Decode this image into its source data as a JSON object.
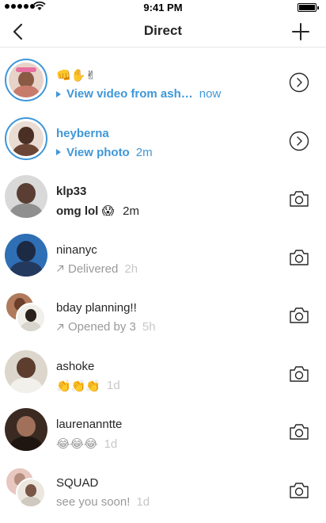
{
  "status_bar": {
    "time": "9:41 PM"
  },
  "header": {
    "title": "Direct"
  },
  "threads": [
    {
      "name": "👊✋✌",
      "subtitle": "View video from ash…",
      "time": "now",
      "action": "chevron-right-icon"
    },
    {
      "name": "heyberna",
      "subtitle": "View photo",
      "time": "2m",
      "action": "chevron-right-icon"
    },
    {
      "name": "klp33",
      "subtitle": "omg lol 😱",
      "time": "2m",
      "action": "camera-icon"
    },
    {
      "name": "ninanyc",
      "subtitle": "Delivered",
      "time": "2h",
      "action": "camera-icon"
    },
    {
      "name": "bday planning!!",
      "subtitle": "Opened by 3",
      "time": "5h",
      "action": "camera-icon"
    },
    {
      "name": "ashoke",
      "subtitle": "👏👏👏",
      "time": "1d",
      "action": "camera-icon"
    },
    {
      "name": "laurenanntte",
      "subtitle": "😂😂😂",
      "time": "1d",
      "action": "camera-icon"
    },
    {
      "name": "SQUAD",
      "subtitle": "see you soon!",
      "time": "1d",
      "action": "camera-icon"
    }
  ],
  "colors": {
    "accent": "#3f97d8",
    "text": "#262626",
    "muted": "#999999",
    "divider": "#e6e6e6"
  }
}
